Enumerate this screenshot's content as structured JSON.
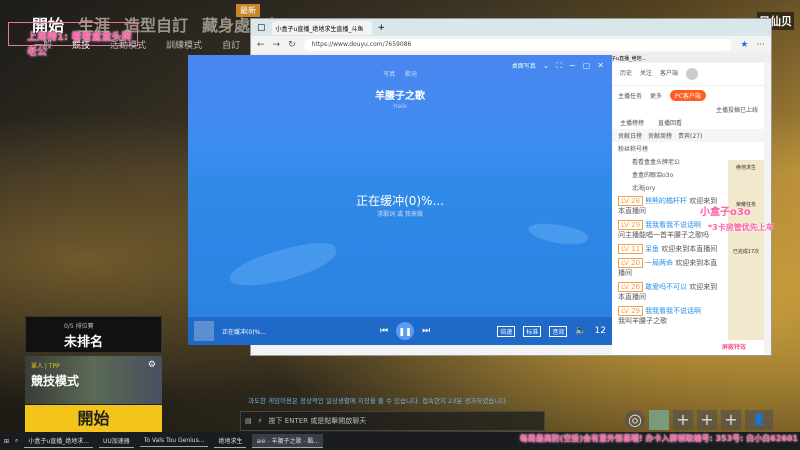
{
  "game": {
    "nav": [
      "開始",
      "生涯",
      "造型自訂",
      "藏身處",
      "商"
    ],
    "sub_tabs": [
      "一般",
      "競技",
      "活動模式",
      "訓練模式",
      "自訂"
    ],
    "new_badge": "最新",
    "rank": {
      "label": "0/5 排位賽",
      "value": "未排名"
    },
    "mode": {
      "tag": "單人 | TPP",
      "name": "競技模式"
    },
    "start": "開始",
    "notice": "과도한 게임이용은 정상적인 일상생활에 지장을 줄 수 있습니다. 접속한지 23분 경과하였습니다.",
    "chat_placeholder": "按下 ENTER 或是點擊開啟聊天"
  },
  "overlay": {
    "top_fan": "上周榜1: 看看盒盒头牌老公",
    "top_right": "只仙贝",
    "weibo_name": "小盒子o3o",
    "notice": "*3卡房管优先上车",
    "ticker": "每局最高防(空投)会有意外惊喜哦! 办卡入群领取编号: 353号: 白小白62601"
  },
  "browser": {
    "tab_title": "小盒子u直播_绝地求生直播_斗鱼",
    "url": "https://www.douyu.com/7659086",
    "bookmark": "小盒子u直播_绝地..."
  },
  "player": {
    "tabs": [
      "写真",
      "歌词"
    ],
    "title": "羊腰子之歌",
    "artist": "Hale",
    "buffering": "正在缓冲(0)%...",
    "sub": "求歌词 或 我来做",
    "mini_status": "正在缓冲(0)%...",
    "quality": [
      "倍速",
      "标准",
      "音效"
    ],
    "count": "12",
    "top_btn": "桌面写真"
  },
  "douyu": {
    "top": [
      "历史",
      "关注",
      "客户端"
    ],
    "task": "主播任务",
    "more": "更多",
    "pc": "PC客户端",
    "pc_sub": "主播投稿已上线",
    "rank_tabs": [
      "主播榜榜",
      "直播回看"
    ],
    "sub_tabs": [
      "贡献日榜",
      "贡献周榜",
      "贵宾(27)"
    ],
    "fans": [
      "粉丝称号榜",
      "看看盒盒头牌老公",
      "盒盒的眼泪o3o",
      "北海jory"
    ],
    "chat": [
      {
        "lv": "LV 28",
        "name": "熊熊的橘杆杆",
        "msg": "欢迎来到本直播间"
      },
      {
        "lv": "LV 29",
        "name": "我我看我不说话啊",
        "msg": "问主播能唱一首羊腰子之歌吗"
      },
      {
        "lv": "LV 11",
        "name": "呆鱼",
        "msg": "欢迎来到本直播间"
      },
      {
        "lv": "LV 20",
        "name": "一局两命",
        "msg": "欢迎来到本直播间"
      },
      {
        "lv": "LV 26",
        "name": "敢爱吗不可以",
        "msg": "欢迎来到本直播间"
      },
      {
        "lv": "LV 29",
        "name": "我我看我不说话啊",
        "msg": "我叫羊腰子之歌"
      }
    ],
    "gift": "屏蔽特效",
    "side": [
      "绝地求生",
      "荣耀任务",
      "已完成17次"
    ]
  },
  "taskbar": {
    "items": [
      "小盒子u直播_绝地求...",
      "UU加速器",
      "To Vals Tou Genius...",
      "绝地求生",
      "aie - 羊腰子之歌 - 酷..."
    ]
  }
}
